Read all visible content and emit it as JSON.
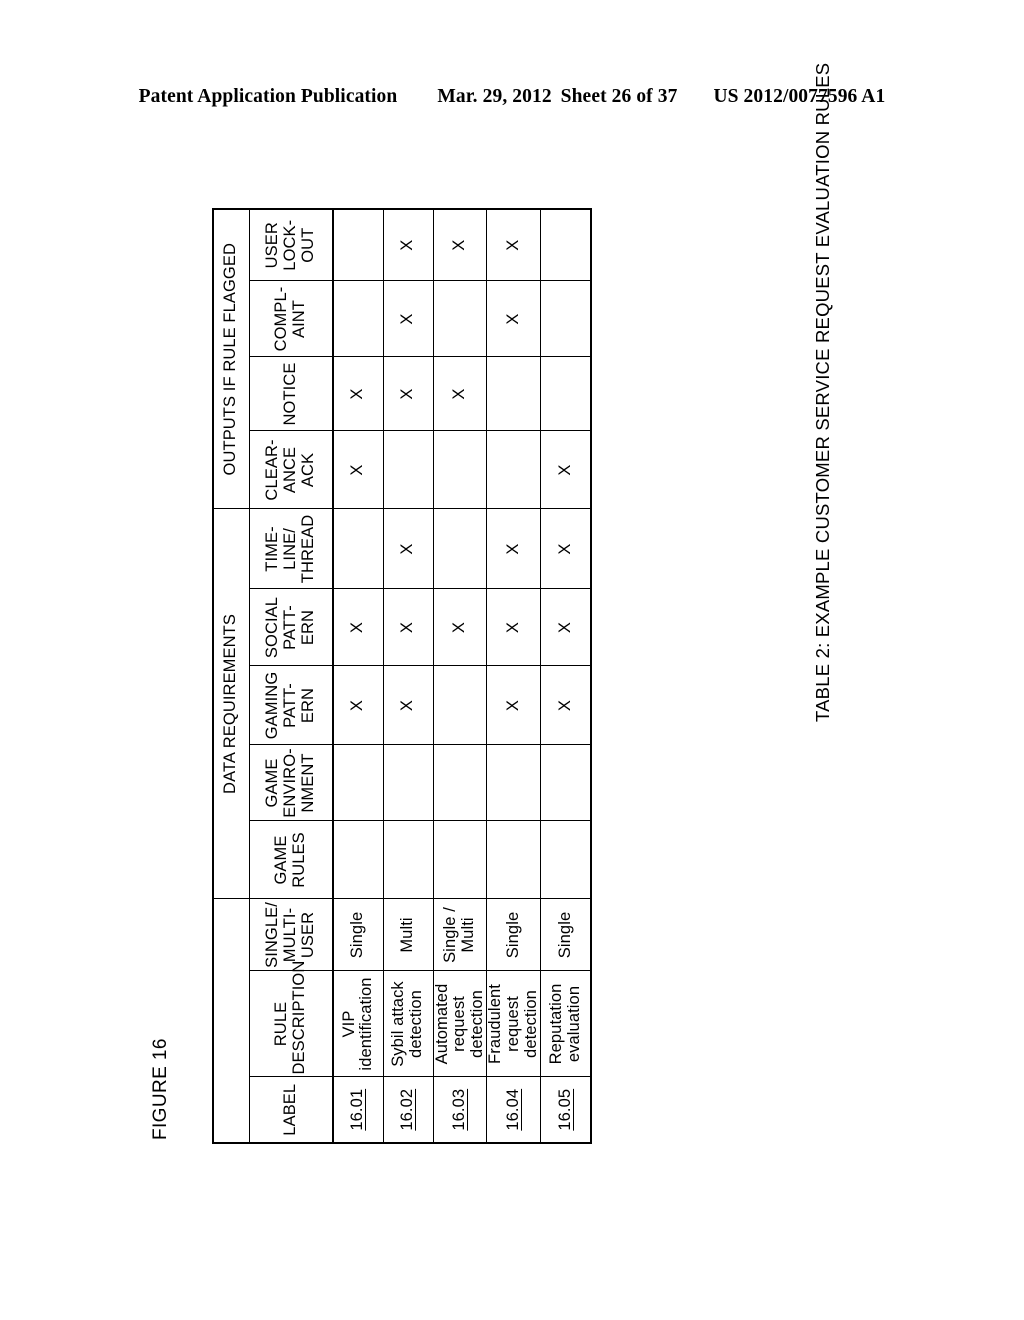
{
  "header": {
    "publication": "Patent Application Publication",
    "date": "Mar. 29, 2012",
    "sheet": "Sheet 26 of 37",
    "number": "US 2012/0077596 A1"
  },
  "figure_label": "FIGURE 16",
  "table_caption": "TABLE 2: EXAMPLE CUSTOMER SERVICE REQUEST EVALUATION RULES",
  "table": {
    "group_headers": [
      {
        "label": "",
        "span": 3
      },
      {
        "label": "DATA REQUIREMENTS",
        "span": 5
      },
      {
        "label": "OUTPUTS IF RULE FLAGGED",
        "span": 4
      }
    ],
    "columns": [
      {
        "key": "label",
        "header": "LABEL"
      },
      {
        "key": "desc",
        "header": "RULE\nDESCRIPTION"
      },
      {
        "key": "sm",
        "header": "SINGLE/\nMULTI-\nUSER"
      },
      {
        "key": "gr",
        "header": "GAME\nRULES"
      },
      {
        "key": "ge",
        "header": "GAME\nENVIRO-\nNMENT"
      },
      {
        "key": "gp",
        "header": "GAMING\nPATT-\nERN"
      },
      {
        "key": "sp",
        "header": "SOCIAL\nPATT-\nERN"
      },
      {
        "key": "tl",
        "header": "TIME-\nLINE/\nTHREAD"
      },
      {
        "key": "ca",
        "header": "CLEAR-\nANCE\nACK"
      },
      {
        "key": "no",
        "header": "NOTICE"
      },
      {
        "key": "co",
        "header": "COMPL-\nAINT"
      },
      {
        "key": "ul",
        "header": "USER\nLOCK-\nOUT"
      }
    ],
    "mark": "X",
    "rows": [
      {
        "label": "16.01",
        "desc": "VIP identification",
        "sm": "Single",
        "gr": "",
        "ge": "",
        "gp": "X",
        "sp": "X",
        "tl": "",
        "ca": "X",
        "no": "X",
        "co": "",
        "ul": ""
      },
      {
        "label": "16.02",
        "desc": "Sybil attack\ndetection",
        "sm": "Multi",
        "gr": "",
        "ge": "",
        "gp": "X",
        "sp": "X",
        "tl": "X",
        "ca": "",
        "no": "X",
        "co": "X",
        "ul": "X"
      },
      {
        "label": "16.03",
        "desc": "Automated\nrequest detection",
        "sm": "Single /\nMulti",
        "gr": "",
        "ge": "",
        "gp": "",
        "sp": "X",
        "tl": "",
        "ca": "",
        "no": "X",
        "co": "",
        "ul": "X"
      },
      {
        "label": "16.04",
        "desc": "Fraudulent\nrequest detection",
        "sm": "Single",
        "gr": "",
        "ge": "",
        "gp": "X",
        "sp": "X",
        "tl": "X",
        "ca": "",
        "no": "",
        "co": "X",
        "ul": "X"
      },
      {
        "label": "16.05",
        "desc": "Reputation\nevaluation",
        "sm": "Single",
        "gr": "",
        "ge": "",
        "gp": "X",
        "sp": "X",
        "tl": "X",
        "ca": "X",
        "no": "",
        "co": "",
        "ul": ""
      }
    ]
  }
}
